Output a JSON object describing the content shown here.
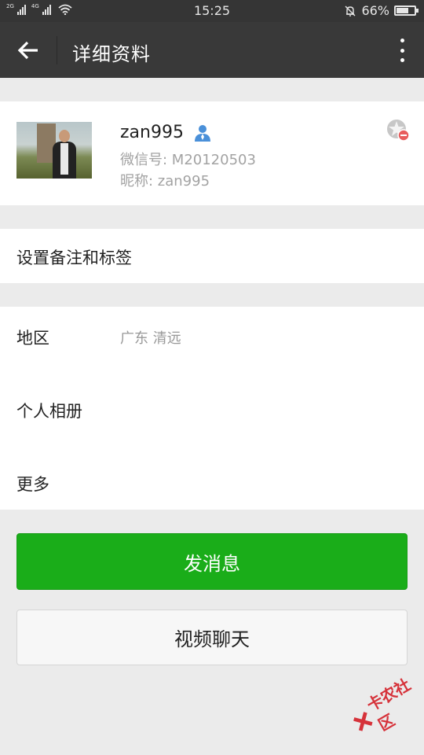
{
  "status_bar": {
    "network_top": "2G",
    "network_bottom": "4G",
    "time": "15:25",
    "battery_text": "66%",
    "battery_level": 0.66
  },
  "title_bar": {
    "back_icon": "arrow-left-icon",
    "title": "详细资料",
    "more_icon": "more-vertical-icon"
  },
  "profile": {
    "name": "zan995",
    "gender_icon": "male-user-icon",
    "wechat_id": "微信号: M20120503",
    "nickname": "昵称: zan995",
    "star_icon": "star-friend-remove-icon"
  },
  "remark": {
    "label": "设置备注和标签"
  },
  "details": {
    "region_label": "地区",
    "region_value": "广东  清远",
    "album_label": "个人相册",
    "more_label": "更多"
  },
  "buttons": {
    "send_message": "发消息",
    "video_chat": "视频聊天"
  },
  "watermark": {
    "text": "卡农社区"
  },
  "colors": {
    "primary_green": "#1aad19",
    "title_bar": "#393939",
    "status_bar": "#353535",
    "background": "#ebebeb"
  }
}
